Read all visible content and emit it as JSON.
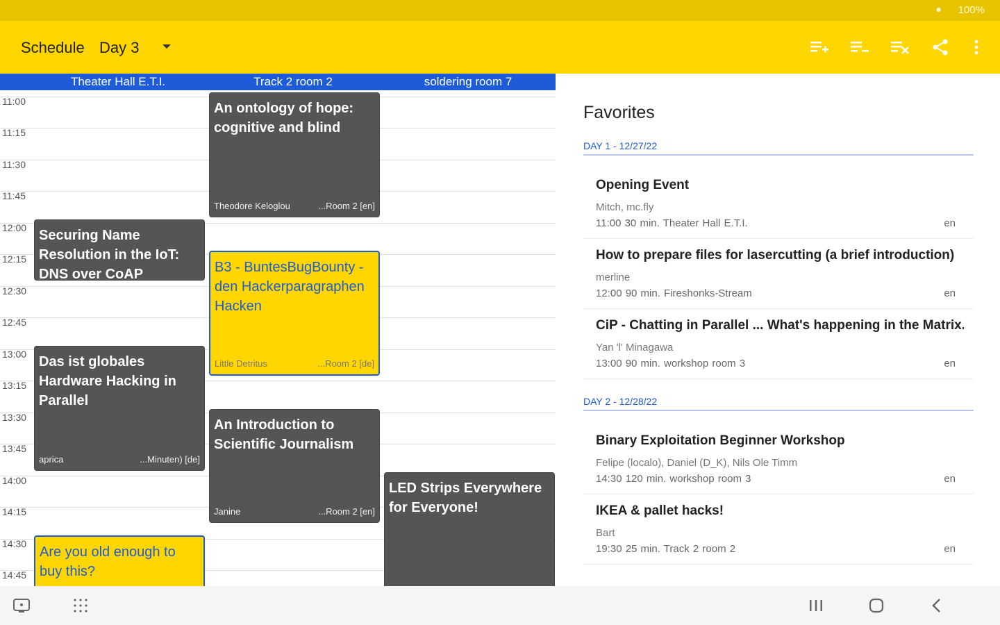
{
  "status_bar": {
    "battery": "100%"
  },
  "app_bar": {
    "title": "Schedule",
    "day": "Day 3"
  },
  "rooms": [
    "Theater Hall E.T.I.",
    "Track 2 room 2",
    "soldering room 7"
  ],
  "times": [
    "11:00",
    "11:15",
    "11:30",
    "11:45",
    "12:00",
    "12:15",
    "12:30",
    "12:45",
    "13:00",
    "13:15",
    "13:30",
    "13:45",
    "14:00",
    "14:15",
    "14:30",
    "14:45"
  ],
  "sessions": [
    {
      "title": "An ontology of hope: cognitive and blind",
      "speaker": "Theodore Keloglou",
      "room": "...Room 2 [en]",
      "favorite": false
    },
    {
      "title": "Securing Name Resolution in the IoT: DNS over CoAP",
      "speaker": "",
      "room": "",
      "favorite": false
    },
    {
      "title": "B3 - BuntesBugBounty - den Hackerparagraphen Hacken",
      "speaker": "Little Detritus",
      "room": "...Room 2 [de]",
      "favorite": true
    },
    {
      "title": "Das ist globales Hardware Hacking in Parallel",
      "speaker": "aprica",
      "room": "...Minuten) [de]",
      "favorite": false
    },
    {
      "title": "An Introduction to Scientific Journalism",
      "speaker": "Janine",
      "room": "...Room 2 [en]",
      "favorite": false
    },
    {
      "title": "LED Strips Everywhere for Everyone!",
      "speaker": "",
      "room": "",
      "favorite": false
    },
    {
      "title": "Are you old enough to buy this?",
      "speaker": "",
      "room": "",
      "favorite": true
    }
  ],
  "favorites": {
    "title": "Favorites",
    "days": [
      {
        "label": "DAY 1 - 12/27/22",
        "items": [
          {
            "title": "Opening Event",
            "speakers": "Mitch, mc.fly",
            "meta": "11:00   30 min.   Theater Hall E.T.I.",
            "lang": "en"
          },
          {
            "title": "How to prepare files for lasercutting (a brief introduction)",
            "speakers": "merline",
            "meta": "12:00   90 min.   Fireshonks-Stream",
            "lang": "en"
          },
          {
            "title": "CiP - Chatting in Parallel ... What's happening in the Matrix...",
            "speakers": "Yan 'l' Minagawa",
            "meta": "13:00   90 min.   workshop room 3",
            "lang": "en"
          }
        ]
      },
      {
        "label": "DAY 2 - 12/28/22",
        "items": [
          {
            "title": "Binary Exploitation Beginner Workshop",
            "speakers": "Felipe (localo), Daniel (D_K), Nils Ole Timm",
            "meta": "14:30   120 min.   workshop room 3",
            "lang": "en"
          },
          {
            "title": "IKEA & pallet hacks!",
            "speakers": "Bart",
            "meta": "19:30   25 min.   Track 2 room 2",
            "lang": "en"
          }
        ]
      }
    ]
  },
  "colors": {
    "primary": "#ffd600",
    "accent": "#1e5bd8",
    "session_dark": "#555555"
  }
}
